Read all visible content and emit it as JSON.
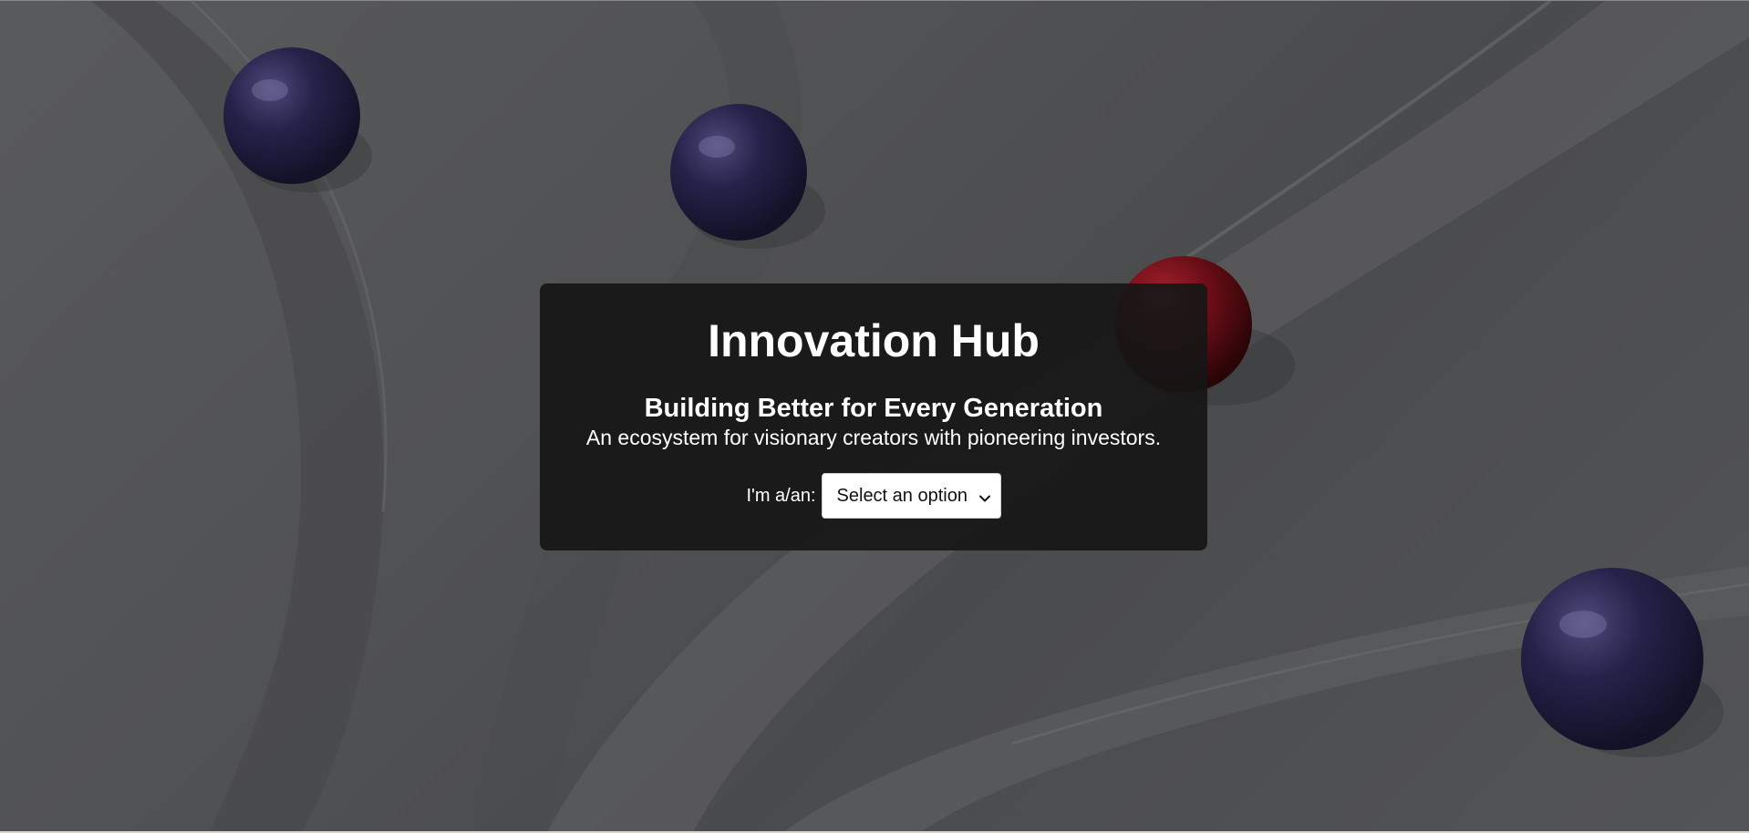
{
  "hero": {
    "title": "Innovation Hub",
    "subtitle": "Building Better for Every Generation",
    "description": "An ecosystem for visionary creators with pioneering investors.",
    "role_label": "I'm a/an:",
    "role_select": {
      "selected": "Select an option",
      "icon": "chevron-down-icon"
    }
  },
  "colors": {
    "card_background": "#161616",
    "text": "#ffffff",
    "marble_blue": "#1f1d3f",
    "marble_red": "#6b0d16"
  }
}
